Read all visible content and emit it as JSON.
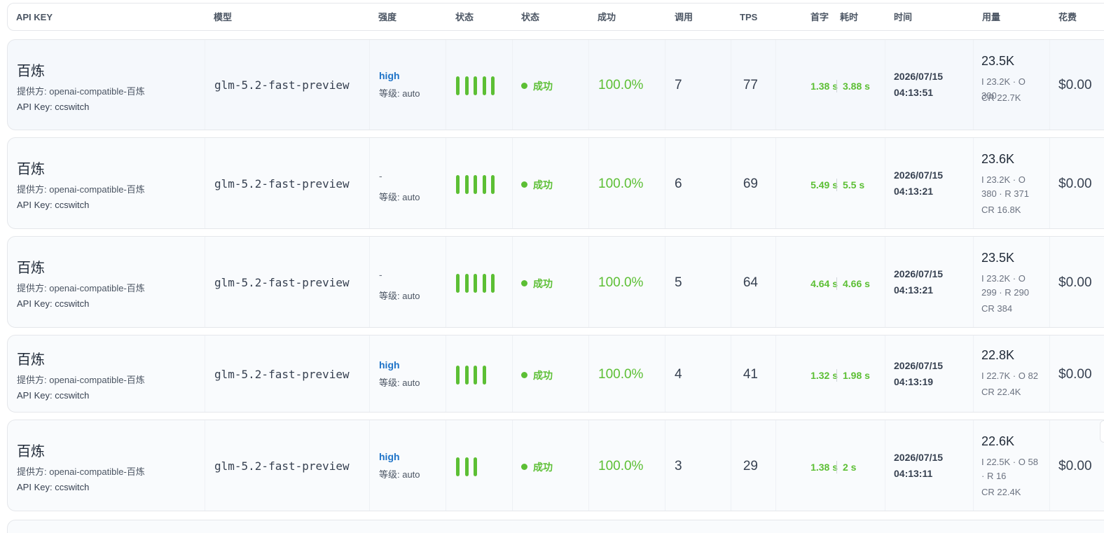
{
  "header": {
    "api_key": "API KEY",
    "model": "模型",
    "strength": "强度",
    "status1": "状态",
    "status2": "状态",
    "success": "成功",
    "calls": "调用",
    "tps": "TPS",
    "ttft": "首字",
    "duration": "耗时",
    "time": "时间",
    "usage": "用量",
    "cost": "花费"
  },
  "rows": [
    {
      "provider": "百炼",
      "provider_sub": "提供方: openai-compatible-百炼",
      "api_key": "API Key: ccswitch",
      "model": "glm-5.2-fast-preview",
      "strength": "high",
      "level": "等级: auto",
      "bars": 5,
      "status": "成功",
      "success": "100.0%",
      "calls": "7",
      "tps": "77",
      "ttft": "1.38 s",
      "duration": "3.88 s",
      "date": "2026/07/15",
      "clock": "04:13:51",
      "usage_total": "23.5K",
      "usage_detail": "I 23.2K · O 300",
      "usage_cr": "CR 22.7K",
      "cost": "$0.00"
    },
    {
      "provider": "百炼",
      "provider_sub": "提供方: openai-compatible-百炼",
      "api_key": "API Key: ccswitch",
      "model": "glm-5.2-fast-preview",
      "strength": "-",
      "level": "等级: auto",
      "bars": 5,
      "status": "成功",
      "success": "100.0%",
      "calls": "6",
      "tps": "69",
      "ttft": "5.49 s",
      "duration": "5.5 s",
      "date": "2026/07/15",
      "clock": "04:13:21",
      "usage_total": "23.6K",
      "usage_detail": "I 23.2K · O 380 · R 371",
      "usage_cr": "CR 16.8K",
      "cost": "$0.00"
    },
    {
      "provider": "百炼",
      "provider_sub": "提供方: openai-compatible-百炼",
      "api_key": "API Key: ccswitch",
      "model": "glm-5.2-fast-preview",
      "strength": "-",
      "level": "等级: auto",
      "bars": 5,
      "status": "成功",
      "success": "100.0%",
      "calls": "5",
      "tps": "64",
      "ttft": "4.64 s",
      "duration": "4.66 s",
      "date": "2026/07/15",
      "clock": "04:13:21",
      "usage_total": "23.5K",
      "usage_detail": "I 23.2K · O 299 · R 290",
      "usage_cr": "CR 384",
      "cost": "$0.00"
    },
    {
      "provider": "百炼",
      "provider_sub": "提供方: openai-compatible-百炼",
      "api_key": "API Key: ccswitch",
      "model": "glm-5.2-fast-preview",
      "strength": "high",
      "level": "等级: auto",
      "bars": 4,
      "status": "成功",
      "success": "100.0%",
      "calls": "4",
      "tps": "41",
      "ttft": "1.32 s",
      "duration": "1.98 s",
      "date": "2026/07/15",
      "clock": "04:13:19",
      "usage_total": "22.8K",
      "usage_detail": "I 22.7K · O 82",
      "usage_cr": "CR 22.4K",
      "cost": "$0.00"
    },
    {
      "provider": "百炼",
      "provider_sub": "提供方: openai-compatible-百炼",
      "api_key": "API Key: ccswitch",
      "model": "glm-5.2-fast-preview",
      "strength": "high",
      "level": "等级: auto",
      "bars": 3,
      "status": "成功",
      "success": "100.0%",
      "calls": "3",
      "tps": "29",
      "ttft": "1.38 s",
      "duration": "2 s",
      "date": "2026/07/15",
      "clock": "04:13:11",
      "usage_total": "22.6K",
      "usage_detail": "I 22.5K · O 58 · R 16",
      "usage_cr": "CR 22.4K",
      "cost": "$0.00"
    }
  ]
}
